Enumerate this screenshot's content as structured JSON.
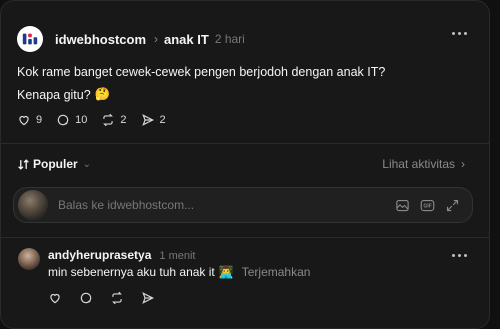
{
  "post": {
    "username": "idwebhostcom",
    "separator": "›",
    "topic": "anak IT",
    "time": "2 hari",
    "line1": "Kok rame banget cewek-cewek pengen berjodoh dengan anak IT?",
    "line2": "Kenapa gitu?",
    "line2_emoji": "🤔",
    "likes": "9",
    "comments": "10",
    "reposts": "2",
    "shares": "2"
  },
  "sort": {
    "label": "Populer",
    "activity": "Lihat aktivitas",
    "activity_chevron": "›"
  },
  "reply": {
    "placeholder": "Balas ke idwebhostcom..."
  },
  "comment": {
    "username": "andyheruprasetya",
    "time": "1 menit",
    "text": "min sebenernya aku tuh anak it",
    "emoji": "👨‍💻",
    "translate": "Terjemahkan"
  },
  "icons": {
    "like": "heart-icon",
    "comment": "comment-icon",
    "repost": "repost-icon",
    "share": "send-icon",
    "image": "image-icon",
    "gif": "gif-icon",
    "expand": "expand-icon",
    "more": "more-icon"
  }
}
